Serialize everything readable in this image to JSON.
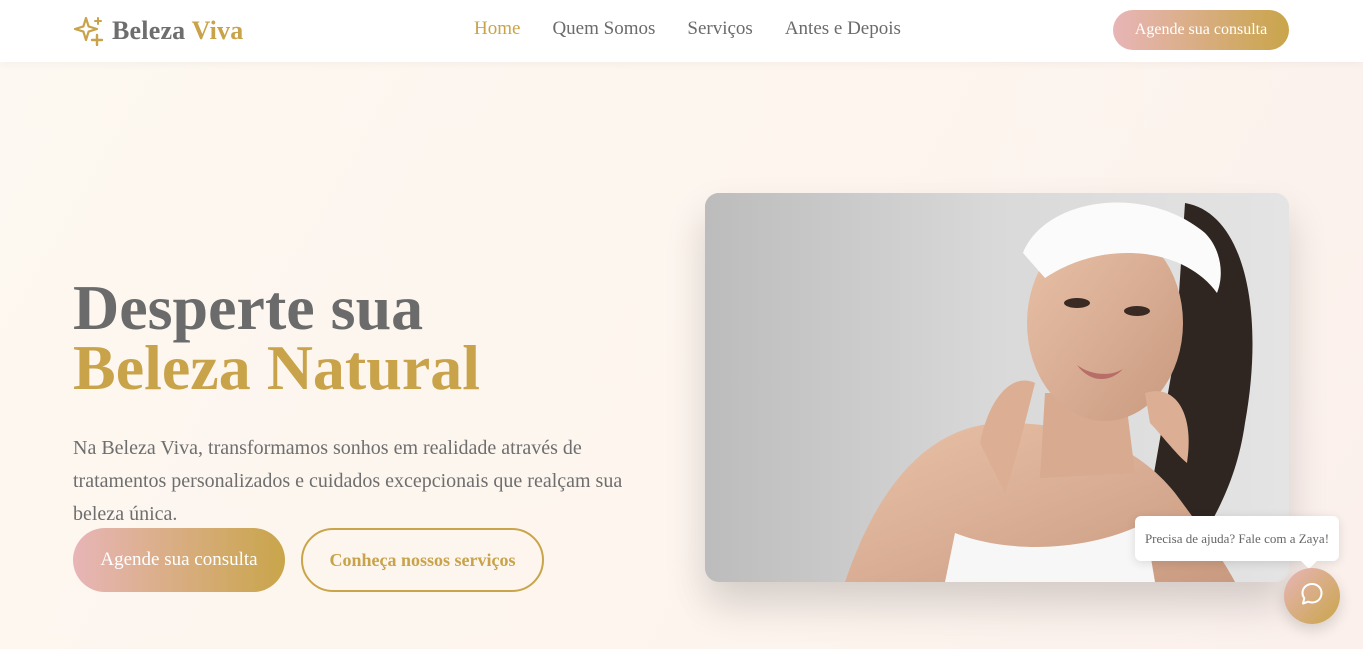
{
  "brand": {
    "name_part1": "Beleza",
    "name_part2": "Viva",
    "logo_icon": "sparkles-icon"
  },
  "nav": {
    "items": [
      {
        "label": "Home",
        "active": true
      },
      {
        "label": "Quem Somos",
        "active": false
      },
      {
        "label": "Serviços",
        "active": false
      },
      {
        "label": "Antes e Depois",
        "active": false
      }
    ],
    "cta_label": "Agende sua consulta"
  },
  "hero": {
    "title_line1": "Desperte sua",
    "title_line2": "Beleza Natural",
    "description": "Na Beleza Viva, transformamos sonhos em realidade através de tratamentos personalizados e cuidados excepcionais que realçam sua beleza única.",
    "primary_button": "Agende sua consulta",
    "secondary_button": "Conheça nossos serviços"
  },
  "chat": {
    "bubble_text": "Precisa de ajuda? Fale com a Zaya!",
    "button_icon": "chat-bubble-icon"
  },
  "colors": {
    "gold": "#c9a34a",
    "pink": "#e8b5b7",
    "text_gray": "#6b6b6b",
    "background": "#fdf8f1"
  }
}
